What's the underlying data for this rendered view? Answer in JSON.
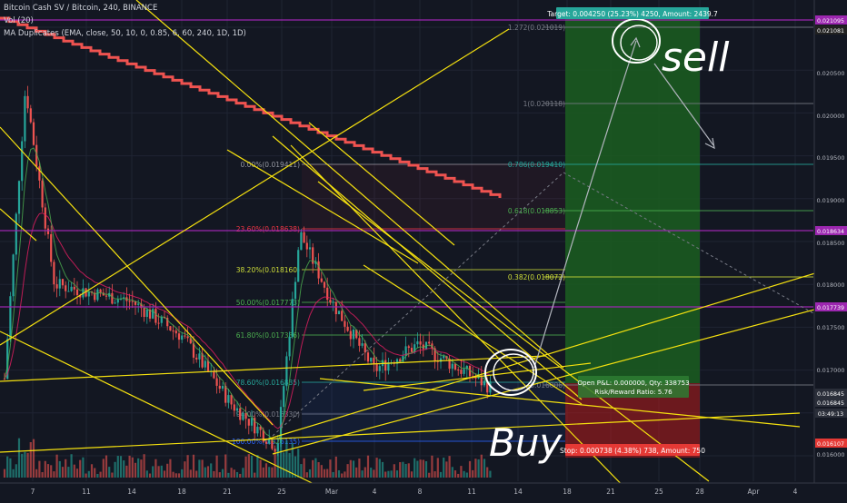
{
  "header": {
    "symbol_line": "Bitcoin Cash SV / Bitcoin, 240, BINANCE",
    "vol_line": "Vol (20)",
    "ma_line": "MA Duplicates (EMA, close, 50, 10, 0, 0.85, 6, 60, 240, 1D, 1D)"
  },
  "price_axis": {
    "ticks": [
      "0.020500",
      "0.020000",
      "0.019500",
      "0.019000",
      "0.018500",
      "0.018000",
      "0.017500",
      "0.017000",
      "0.016500",
      "0.016000"
    ],
    "markers": [
      {
        "value": "0.021095",
        "color": "#9c27b0"
      },
      {
        "value": "0.021081",
        "color": "#212121"
      },
      {
        "value": "0.018634",
        "color": "#9c27b0"
      },
      {
        "value": "0.017739",
        "color": "#9c27b0"
      },
      {
        "value": "0.016845",
        "color": "#2a2e39"
      },
      {
        "value": "0.016845",
        "color": "#2a2e39"
      },
      {
        "value": "03:49:13",
        "color": "#2a2e39"
      },
      {
        "value": "0.016107",
        "color": "#e53935"
      }
    ]
  },
  "time_axis": {
    "ticks": [
      "7",
      "11",
      "14",
      "18",
      "21",
      "25",
      "Mar",
      "4",
      "8",
      "11",
      "14",
      "18",
      "21",
      "25",
      "28",
      "Apr",
      "4"
    ]
  },
  "fib_left": {
    "levels": [
      {
        "label": "0.00%(0.019411)",
        "color": "#9598a1"
      },
      {
        "label": "23.60%(0.018638)",
        "color": "#f23645"
      },
      {
        "label": "38.20%(0.018160)",
        "color": "#cddc39"
      },
      {
        "label": "50.00%(0.017773)",
        "color": "#4caf50"
      },
      {
        "label": "61.80%(0.017386)",
        "color": "#4caf50"
      },
      {
        "label": "78.60%(0.016835)",
        "color": "#26a69a"
      },
      {
        "label": "94.00%(0.016330)",
        "color": "#787b86"
      },
      {
        "label": "100.00%(0.016135)",
        "color": "#2962ff"
      }
    ]
  },
  "fib_right": {
    "levels": [
      {
        "label": "1.272(0.021019)",
        "color": "#787b86"
      },
      {
        "label": "1(0.020118)",
        "color": "#787b86"
      },
      {
        "label": "0.786(0.019410)",
        "color": "#26a69a"
      },
      {
        "label": "0.618(0.018853)",
        "color": "#4caf50"
      },
      {
        "label": "0.382(0.018072)",
        "color": "#cddc39"
      },
      {
        "label": "(0.016806)",
        "color": "#787b86"
      }
    ]
  },
  "position": {
    "target_label": "Target: 0.004250 (25.23%) 4250, Amount: 2439.7",
    "stop_label": "Stop: 0.000738 (4.38%) 738, Amount: 750",
    "pnl_label": "Open P&L: 0.000000, Qty: 338753",
    "rr_label": "Risk/Reward Ratio: 5.76"
  },
  "annotations": {
    "sell_text": "sell",
    "buy_text": "Buy"
  },
  "chart_data": {
    "type": "candlestick",
    "symbol": "BSVBTC",
    "timeframe": "240",
    "exchange": "BINANCE",
    "ylim": [
      0.0159,
      0.0212
    ],
    "x_ticks": [
      "7",
      "11",
      "14",
      "18",
      "21",
      "25",
      "Mar",
      "4",
      "8",
      "11",
      "14",
      "18",
      "21",
      "25",
      "28",
      "Apr",
      "4"
    ],
    "price_path": [
      {
        "t": "7",
        "close": 0.0169
      },
      {
        "t": "7",
        "close": 0.0203
      },
      {
        "t": "11",
        "close": 0.018
      },
      {
        "t": "14",
        "close": 0.0178
      },
      {
        "t": "18",
        "close": 0.0174
      },
      {
        "t": "21",
        "close": 0.0166
      },
      {
        "t": "25",
        "close": 0.0161
      },
      {
        "t": "25",
        "close": 0.0186
      },
      {
        "t": "Mar",
        "close": 0.0178
      },
      {
        "t": "4",
        "close": 0.017
      },
      {
        "t": "8",
        "close": 0.0173
      },
      {
        "t": "11",
        "close": 0.0168
      }
    ],
    "horizontal_levels": [
      0.021095,
      0.018634,
      0.017739
    ],
    "entry": 0.016806,
    "target": 0.021056,
    "stop": 0.016068,
    "risk_reward": 5.76
  }
}
